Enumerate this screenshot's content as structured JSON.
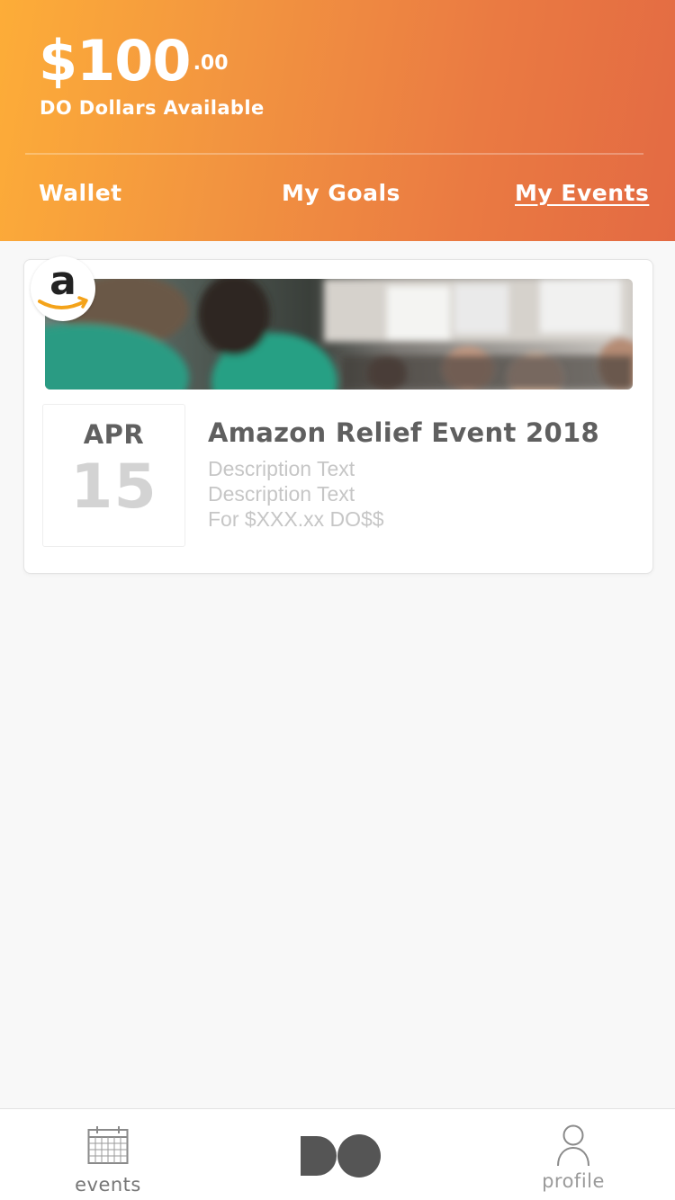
{
  "header": {
    "balance_main": "$100",
    "balance_cents": ".00",
    "balance_caption": "DO Dollars Available",
    "tabs": [
      {
        "label": "Wallet",
        "active": false
      },
      {
        "label": "My Goals",
        "active": false
      },
      {
        "label": "My Events",
        "active": true
      }
    ],
    "gradient_colors": [
      "#fdad38",
      "#e36a43"
    ]
  },
  "event_card": {
    "brand_logo_icon": "amazon-logo-icon",
    "brand_letter": "a",
    "date_month": "APR",
    "date_day": "15",
    "title": "Amazon Relief Event 2018",
    "description_lines": [
      "Description Text",
      "Description Text",
      "For $XXX.xx DO$$"
    ]
  },
  "bottom_nav": {
    "items": [
      {
        "label": "events",
        "icon": "calendar-icon"
      },
      {
        "label": "",
        "icon": "do-logo-icon"
      },
      {
        "label": "profile",
        "icon": "person-icon"
      }
    ]
  }
}
